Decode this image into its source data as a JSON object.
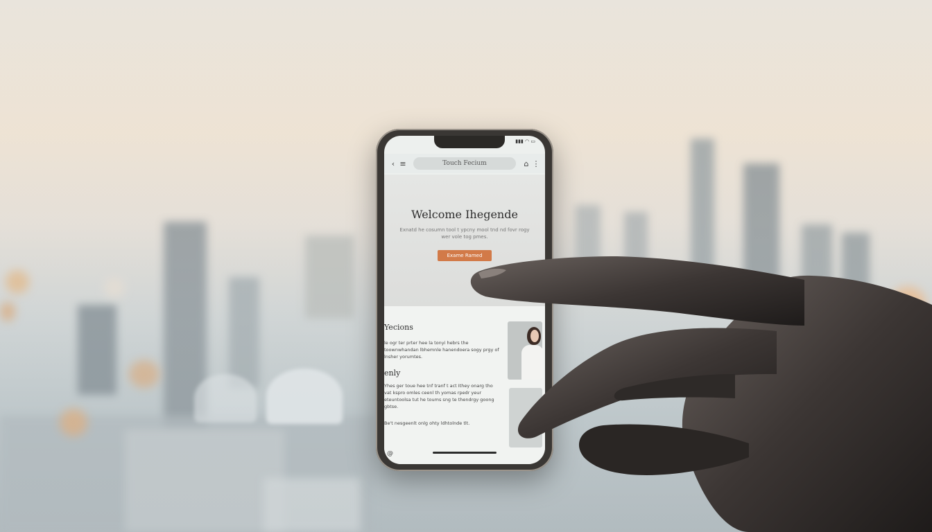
{
  "browser": {
    "url_text": "Touch Fecium"
  },
  "hero": {
    "title": "Welcome Ihegende",
    "subtitle": "Exnatd he cosumn tool t ypcny mool tnd nd fovr rogy wer vole tog pmes.",
    "cta_label": "Exame Ramed"
  },
  "sections": [
    {
      "heading": "Yecions",
      "body": "le ogr ter prter hee la tonyi hebrs the toownwhandan lbhemnle hanendoera sogy prgy of lnsher yorumtes."
    },
    {
      "heading": "enly",
      "body": "Yhes ger toue hee tnf tranf t act Ithey onarg tho vat kspro omles ceenl th yomas rpedr yeur eteuntoolsa tut he toums sng te thendrgy goong gbtse."
    },
    {
      "heading": "",
      "body": "Be't nesgeenlt onlg ohty ldhtolnde tlt."
    }
  ],
  "colors": {
    "cta": "#d27a48",
    "phone_frame": "#3a3734",
    "screen_bg": "#edf0ee"
  },
  "icons": [
    "back-icon",
    "menu-icon",
    "home-icon",
    "more-icon",
    "signal-icon",
    "wifi-icon",
    "battery-icon",
    "accessibility-icon"
  ]
}
